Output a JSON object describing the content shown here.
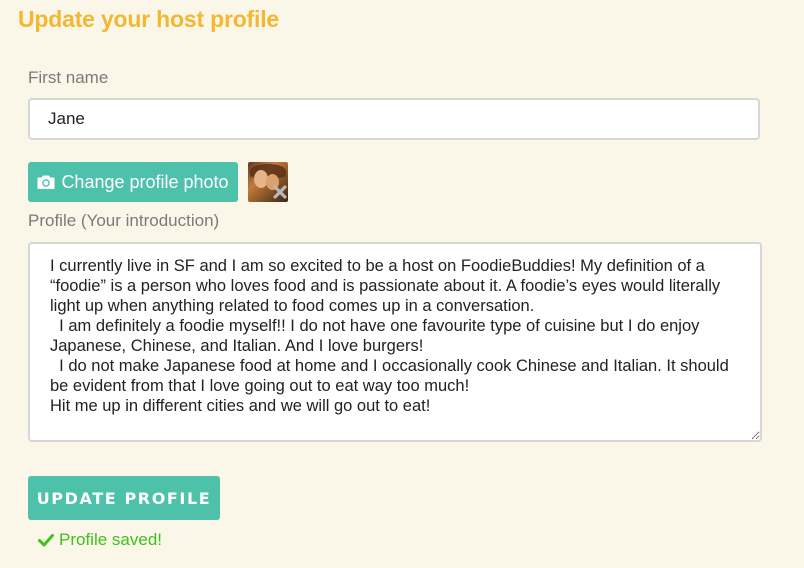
{
  "page": {
    "title": "Update your host profile"
  },
  "form": {
    "first_name": {
      "label": "First name",
      "value": "Jane"
    },
    "photo": {
      "button_label": "Change profile photo",
      "button_icon": "camera-icon",
      "remove_icon": "close-icon"
    },
    "profile": {
      "label": "Profile (Your introduction)",
      "value": "I currently live in SF and I am so excited to be a host on FoodieBuddies! My definition of a “foodie” is a person who loves food and is passionate about it. A foodie’s eyes would literally light up when anything related to food comes up in a conversation.\n  I am definitely a foodie myself!! I do not have one favourite type of cuisine but I do enjoy Japanese, Chinese, and Italian. And I love burgers!\n  I do not make Japanese food at home and I occasionally cook Chinese and Italian. It should be evident from that I love going out to eat way too much!\nHit me up in different cities and we will go out to eat!"
    },
    "submit_label": "UPDATE PROFILE",
    "status": {
      "text": "Profile saved!",
      "icon": "check-icon"
    }
  },
  "colors": {
    "background": "#fbf7e8",
    "title": "#f5b731",
    "accent": "#4dc1a9",
    "success": "#3cc21c",
    "label": "#7a7a7a"
  }
}
